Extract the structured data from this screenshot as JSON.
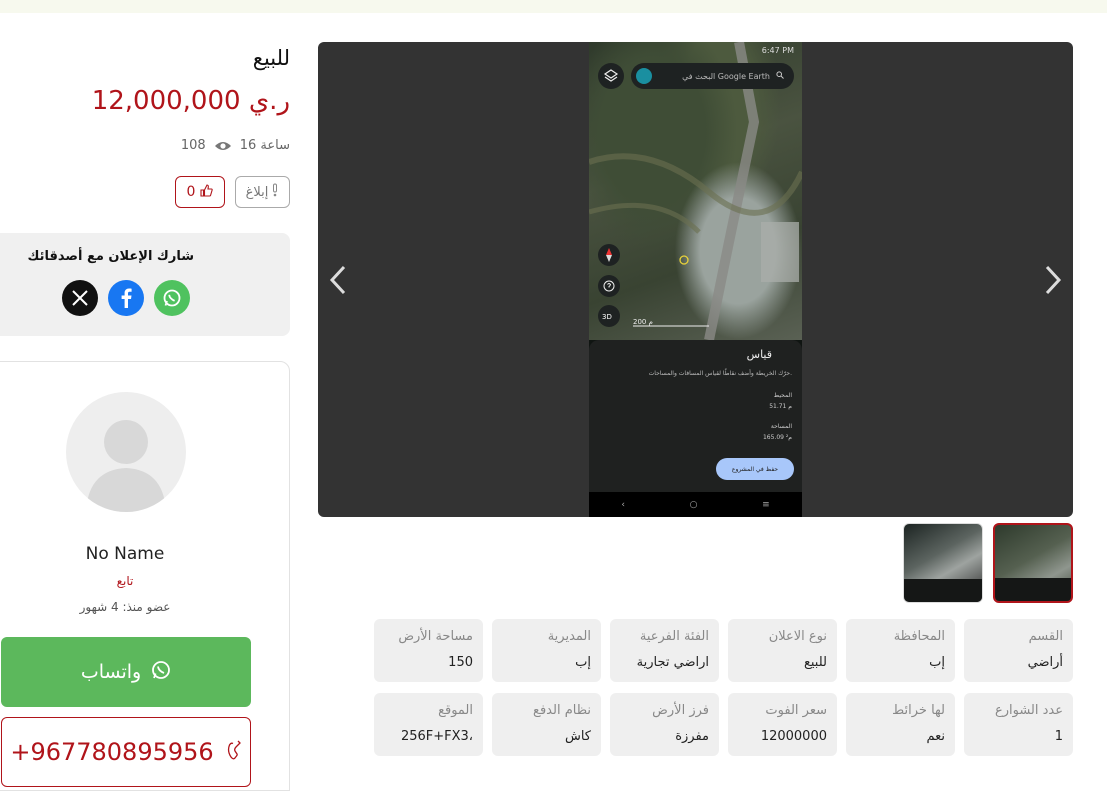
{
  "listing": {
    "status": "للبيع",
    "price": "12,000,000 ر.ي",
    "time_ago": "16 ساعة",
    "views": "108",
    "likes": "0",
    "report_label": "إبلاغ"
  },
  "share": {
    "title": "شارك الإعلان مع أصدقائك",
    "icons": [
      "x-icon",
      "facebook-icon",
      "whatsapp-icon"
    ]
  },
  "seller": {
    "name": "No Name",
    "follow_label": "تابع",
    "member_since": "عضو منذ: 4 شهور",
    "whatsapp_label": "واتساب",
    "phone": "+967780895956"
  },
  "screenshot": {
    "status_time": "6:47 PM",
    "search_placeholder": "البحث في Google Earth",
    "scale": "200 م",
    "panel_title": "قياس",
    "panel_desc": "حرّك الخريطة وأضف نقاطًا لقياس المسافات والمساحات.",
    "perimeter_label": "المحيط",
    "perimeter_value": "51.71 م",
    "area_label": "المساحة",
    "area_value": "165.09 م²",
    "save_label": "حفظ في المشروع"
  },
  "specs_row1": [
    {
      "label": "القسم",
      "value": "أراضي"
    },
    {
      "label": "المحافظة",
      "value": "إب"
    },
    {
      "label": "نوع الاعلان",
      "value": "للبيع"
    },
    {
      "label": "الفئة الفرعية",
      "value": "اراضي تجارية"
    },
    {
      "label": "المديرية",
      "value": "إب"
    },
    {
      "label": "مساحة الأرض",
      "value": "150"
    }
  ],
  "specs_row2": [
    {
      "label": "عدد الشوارع",
      "value": "1"
    },
    {
      "label": "لها خرائط",
      "value": "نعم"
    },
    {
      "label": "سعر الفوت",
      "value": "12000000"
    },
    {
      "label": "فرز الأرض",
      "value": "مفرزة"
    },
    {
      "label": "نظام الدفع",
      "value": "كاش"
    },
    {
      "label": "الموقع",
      "value": "256F+FX3،"
    }
  ],
  "colors": {
    "accent": "#b0141a",
    "whatsapp": "#5cb85c",
    "card_bg": "#efefef"
  }
}
